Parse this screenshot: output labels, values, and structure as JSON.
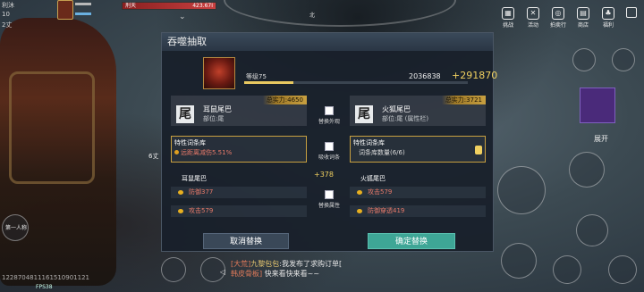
{
  "hud": {
    "status_lines": [
      "利沐",
      "10",
      "2丈"
    ],
    "target_name": "刑天",
    "target_hp": "423.67I",
    "compass": "北",
    "coords": "1228704811161510901121",
    "fps": "FPS38",
    "person_view": "第一人称",
    "distance_label": "6丈",
    "expand_label": "展开"
  },
  "top_menu": [
    {
      "label": "挑战",
      "icon": "challenge-icon"
    },
    {
      "label": "活动",
      "icon": "activity-icon"
    },
    {
      "label": "拍卖行",
      "icon": "auction-icon"
    },
    {
      "label": "商店",
      "icon": "shop-icon"
    },
    {
      "label": "福利",
      "icon": "welfare-icon"
    }
  ],
  "dialog": {
    "title": "吞噬抽取",
    "level_label": "等级75",
    "exp_value": "2036838",
    "exp_gain": "+291870",
    "exp_progress": 0.22,
    "left_item": {
      "power": "总实力:4650",
      "name": "耳鼠尾巴",
      "slot": "部位:尾",
      "icon_glyph": "尾"
    },
    "right_item": {
      "power": "总实力:3721",
      "name": "火狐尾巴",
      "slot": "部位:尾 (属性栏)",
      "icon_glyph": "尾"
    },
    "replace_look": "替换外观",
    "absorb_entry": "吸收词条",
    "replace_attr": "替换属性",
    "left_trait": {
      "title": "特性词条库",
      "line": "远距离减伤5.51%"
    },
    "right_trait": {
      "title": "特性词条库",
      "line": "词条库数量(6/6)"
    },
    "attr_gain": "+378",
    "left_attrs": {
      "name": "耳鼠尾巴",
      "rows": [
        "防御377",
        "攻击579"
      ]
    },
    "right_attrs": {
      "name": "火狐尾巴",
      "rows": [
        "攻击579",
        "防御穿透419"
      ]
    },
    "cancel_label": "取消替换",
    "confirm_label": "确定替换"
  },
  "chat": {
    "line1_prefix": "[大荒]",
    "line1_name": "九黎包包",
    "line1_text": ":我发布了求购订单[",
    "line2_tag": "韩皮骨板]",
    "line2_text": " 快来看快来看~~"
  }
}
